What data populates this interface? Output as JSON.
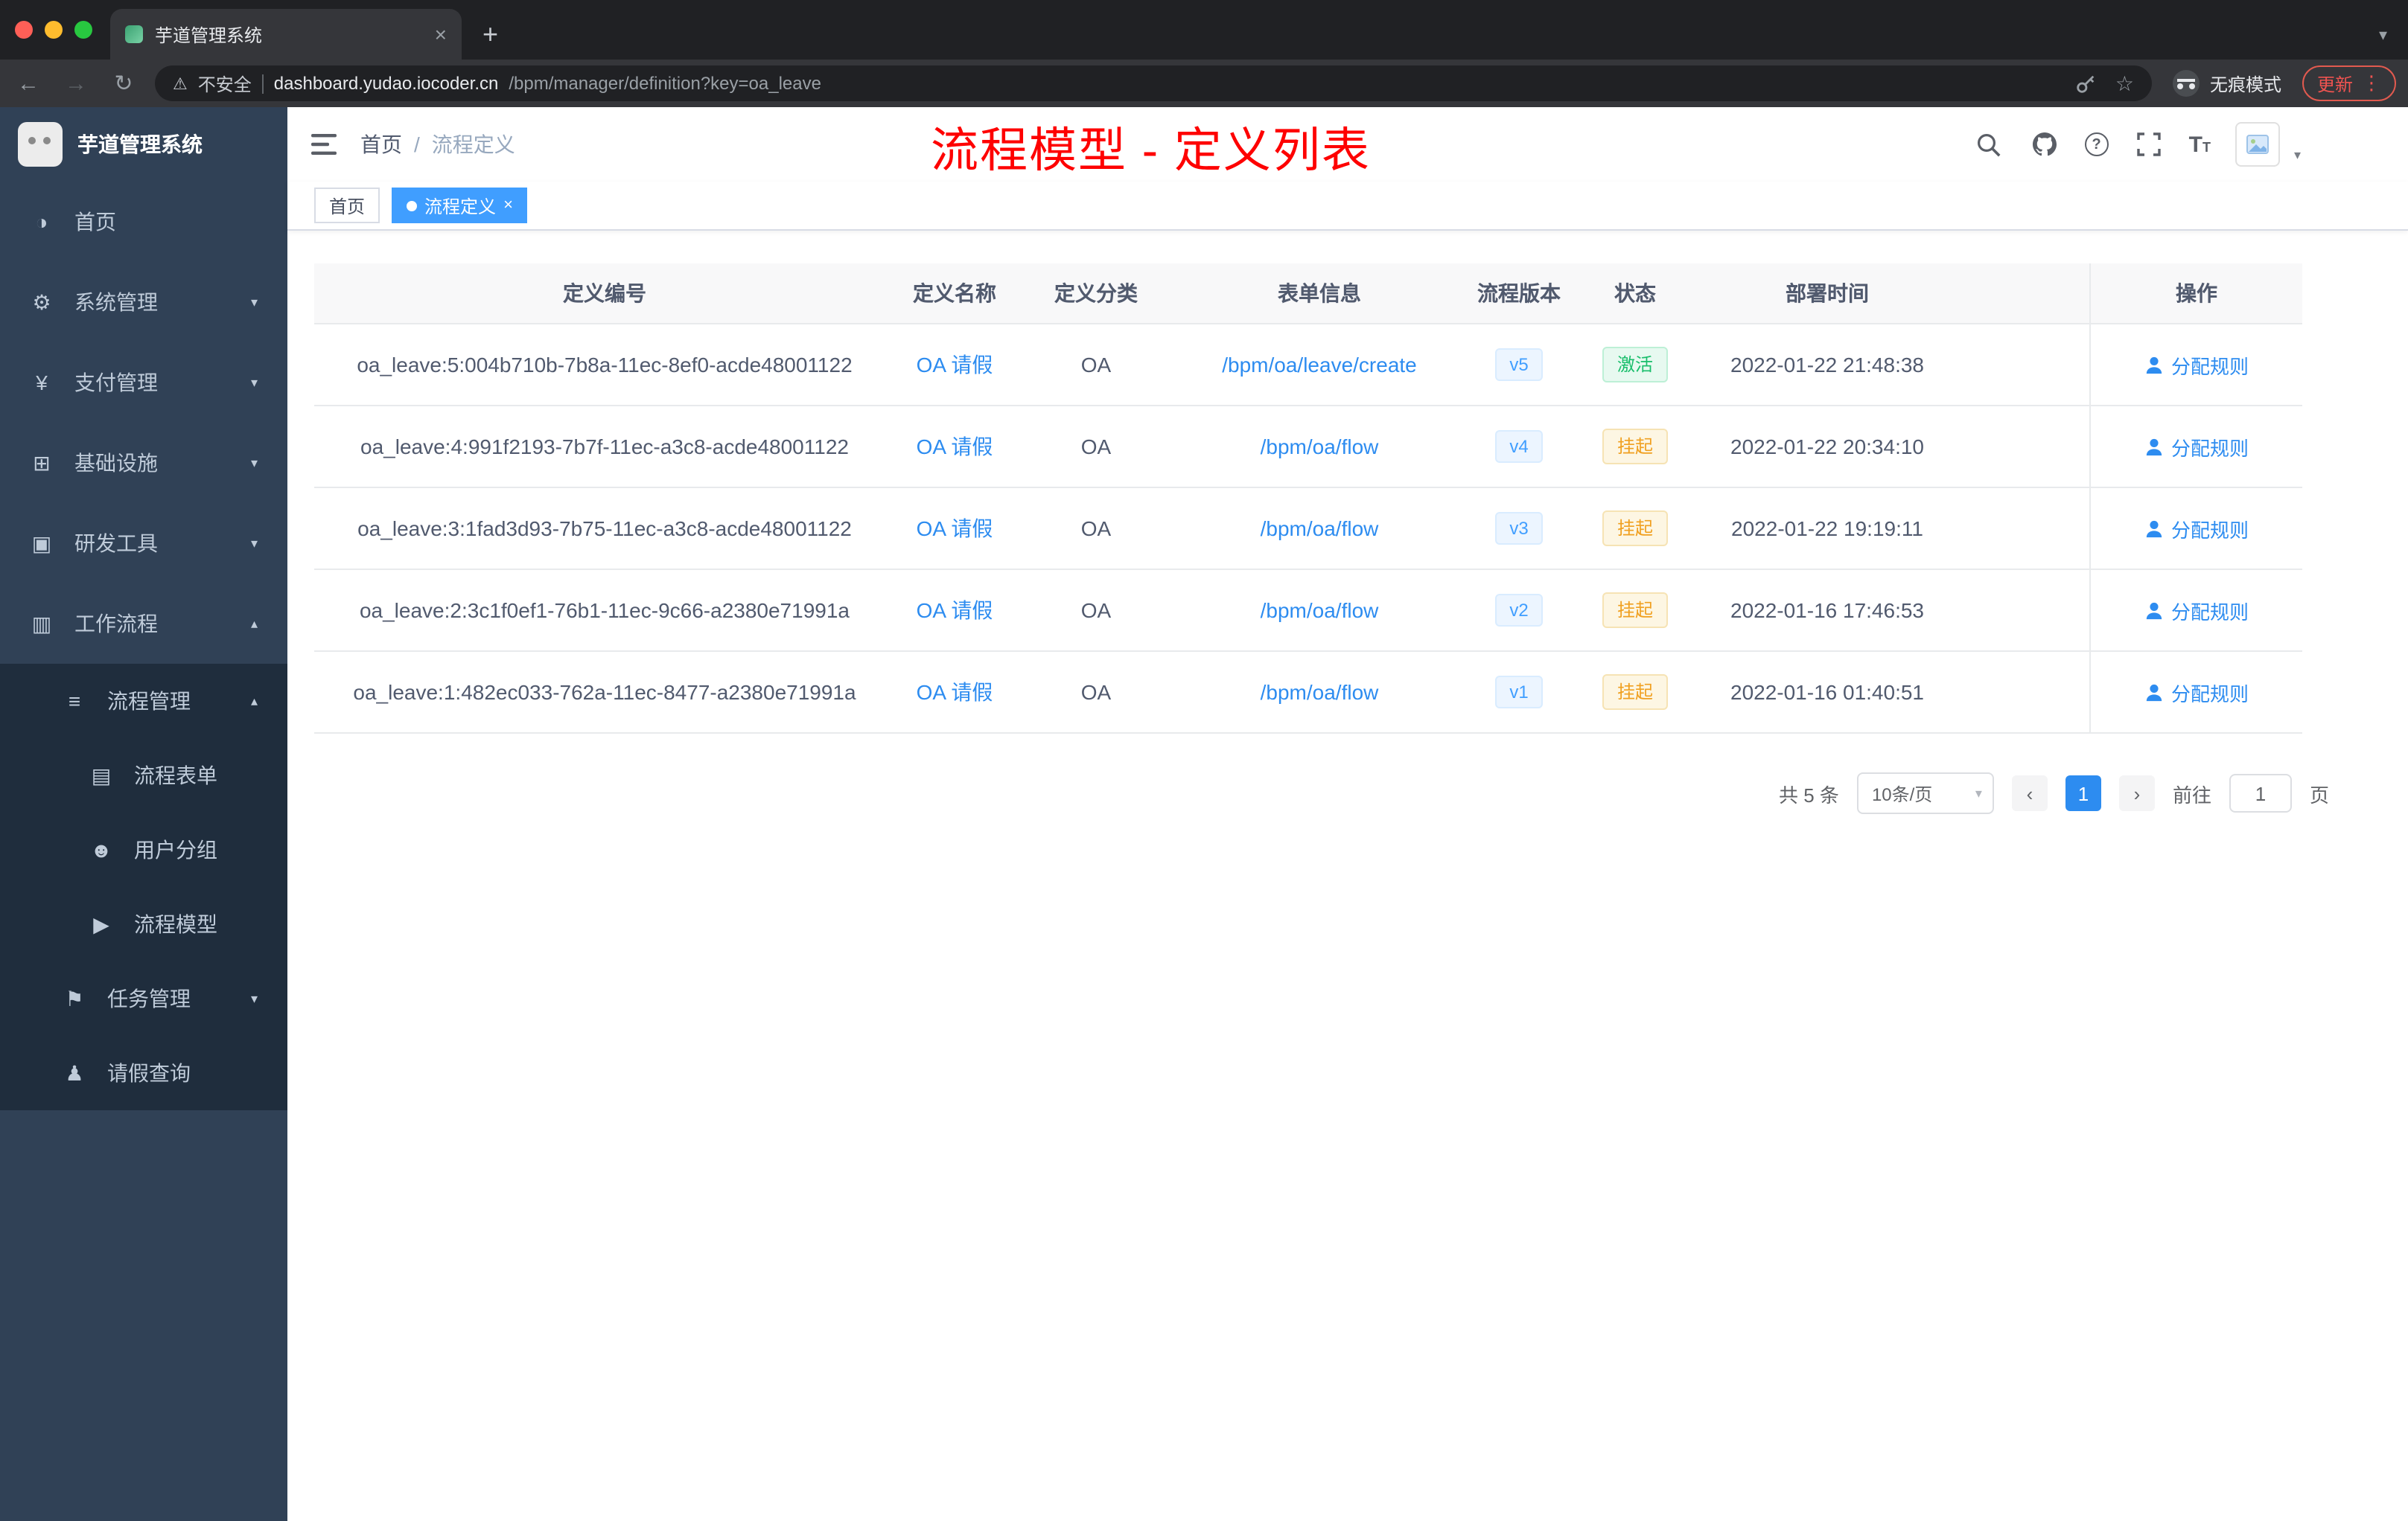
{
  "browser": {
    "tab_title": "芋道管理系统",
    "new_tab": "+",
    "tab_close": "×",
    "back": "←",
    "forward": "→",
    "refresh": "↻",
    "warning_glyph": "⚠",
    "security_label": "不安全",
    "url_domain": "dashboard.yudao.iocoder.cn",
    "url_path": "/bpm/manager/definition?key=oa_leave",
    "star": "☆",
    "incognito_label": "无痕模式",
    "update_label": "更新",
    "menu_dots": "⋮",
    "strip_caret": "▾"
  },
  "sidebar": {
    "logo_title": "芋道管理系统",
    "items": [
      {
        "label": "首页",
        "icon": "◑",
        "chevron": ""
      },
      {
        "label": "系统管理",
        "icon": "⚙",
        "chevron": "▾"
      },
      {
        "label": "支付管理",
        "icon": "¥",
        "chevron": "▾"
      },
      {
        "label": "基础设施",
        "icon": "⊞",
        "chevron": "▾"
      },
      {
        "label": "研发工具",
        "icon": "▣",
        "chevron": "▾"
      },
      {
        "label": "工作流程",
        "icon": "▥",
        "chevron": "▴"
      },
      {
        "label": "流程管理",
        "icon": "≡",
        "chevron": "▴"
      },
      {
        "label": "流程表单",
        "icon": "▤",
        "chevron": ""
      },
      {
        "label": "用户分组",
        "icon": "☻",
        "chevron": ""
      },
      {
        "label": "流程模型",
        "icon": "▶",
        "chevron": ""
      },
      {
        "label": "任务管理",
        "icon": "⚑",
        "chevron": "▾"
      },
      {
        "label": "请假查询",
        "icon": "♟",
        "chevron": ""
      }
    ]
  },
  "header": {
    "breadcrumb_home": "首页",
    "breadcrumb_sep": "/",
    "breadcrumb_current": "流程定义",
    "annotation": "流程模型 - 定义列表",
    "caret": "▾"
  },
  "tags": {
    "home": "首页",
    "current": "流程定义",
    "close": "×"
  },
  "table": {
    "columns": [
      "定义编号",
      "定义名称",
      "定义分类",
      "表单信息",
      "流程版本",
      "状态",
      "部署时间",
      "操作"
    ],
    "rows": [
      {
        "id": "oa_leave:5:004b710b-7b8a-11ec-8ef0-acde48001122",
        "name": "OA 请假",
        "category": "OA",
        "form": "/bpm/oa/leave/create",
        "version": "v5",
        "status": "激活",
        "status_type": "success",
        "time": "2022-01-22 21:48:38",
        "action": "分配规则"
      },
      {
        "id": "oa_leave:4:991f2193-7b7f-11ec-a3c8-acde48001122",
        "name": "OA 请假",
        "category": "OA",
        "form": "/bpm/oa/flow",
        "version": "v4",
        "status": "挂起",
        "status_type": "warning",
        "time": "2022-01-22 20:34:10",
        "action": "分配规则"
      },
      {
        "id": "oa_leave:3:1fad3d93-7b75-11ec-a3c8-acde48001122",
        "name": "OA 请假",
        "category": "OA",
        "form": "/bpm/oa/flow",
        "version": "v3",
        "status": "挂起",
        "status_type": "warning",
        "time": "2022-01-22 19:19:11",
        "action": "分配规则"
      },
      {
        "id": "oa_leave:2:3c1f0ef1-76b1-11ec-9c66-a2380e71991a",
        "name": "OA 请假",
        "category": "OA",
        "form": "/bpm/oa/flow",
        "version": "v2",
        "status": "挂起",
        "status_type": "warning",
        "time": "2022-01-16 17:46:53",
        "action": "分配规则"
      },
      {
        "id": "oa_leave:1:482ec033-762a-11ec-8477-a2380e71991a",
        "name": "OA 请假",
        "category": "OA",
        "form": "/bpm/oa/flow",
        "version": "v1",
        "status": "挂起",
        "status_type": "warning",
        "time": "2022-01-16 01:40:51",
        "action": "分配规则"
      }
    ]
  },
  "pagination": {
    "total": "共 5 条",
    "page_size": "10条/页",
    "prev": "‹",
    "next": "›",
    "current": "1",
    "goto_label": "前往",
    "goto_value": "1",
    "page_unit": "页"
  }
}
